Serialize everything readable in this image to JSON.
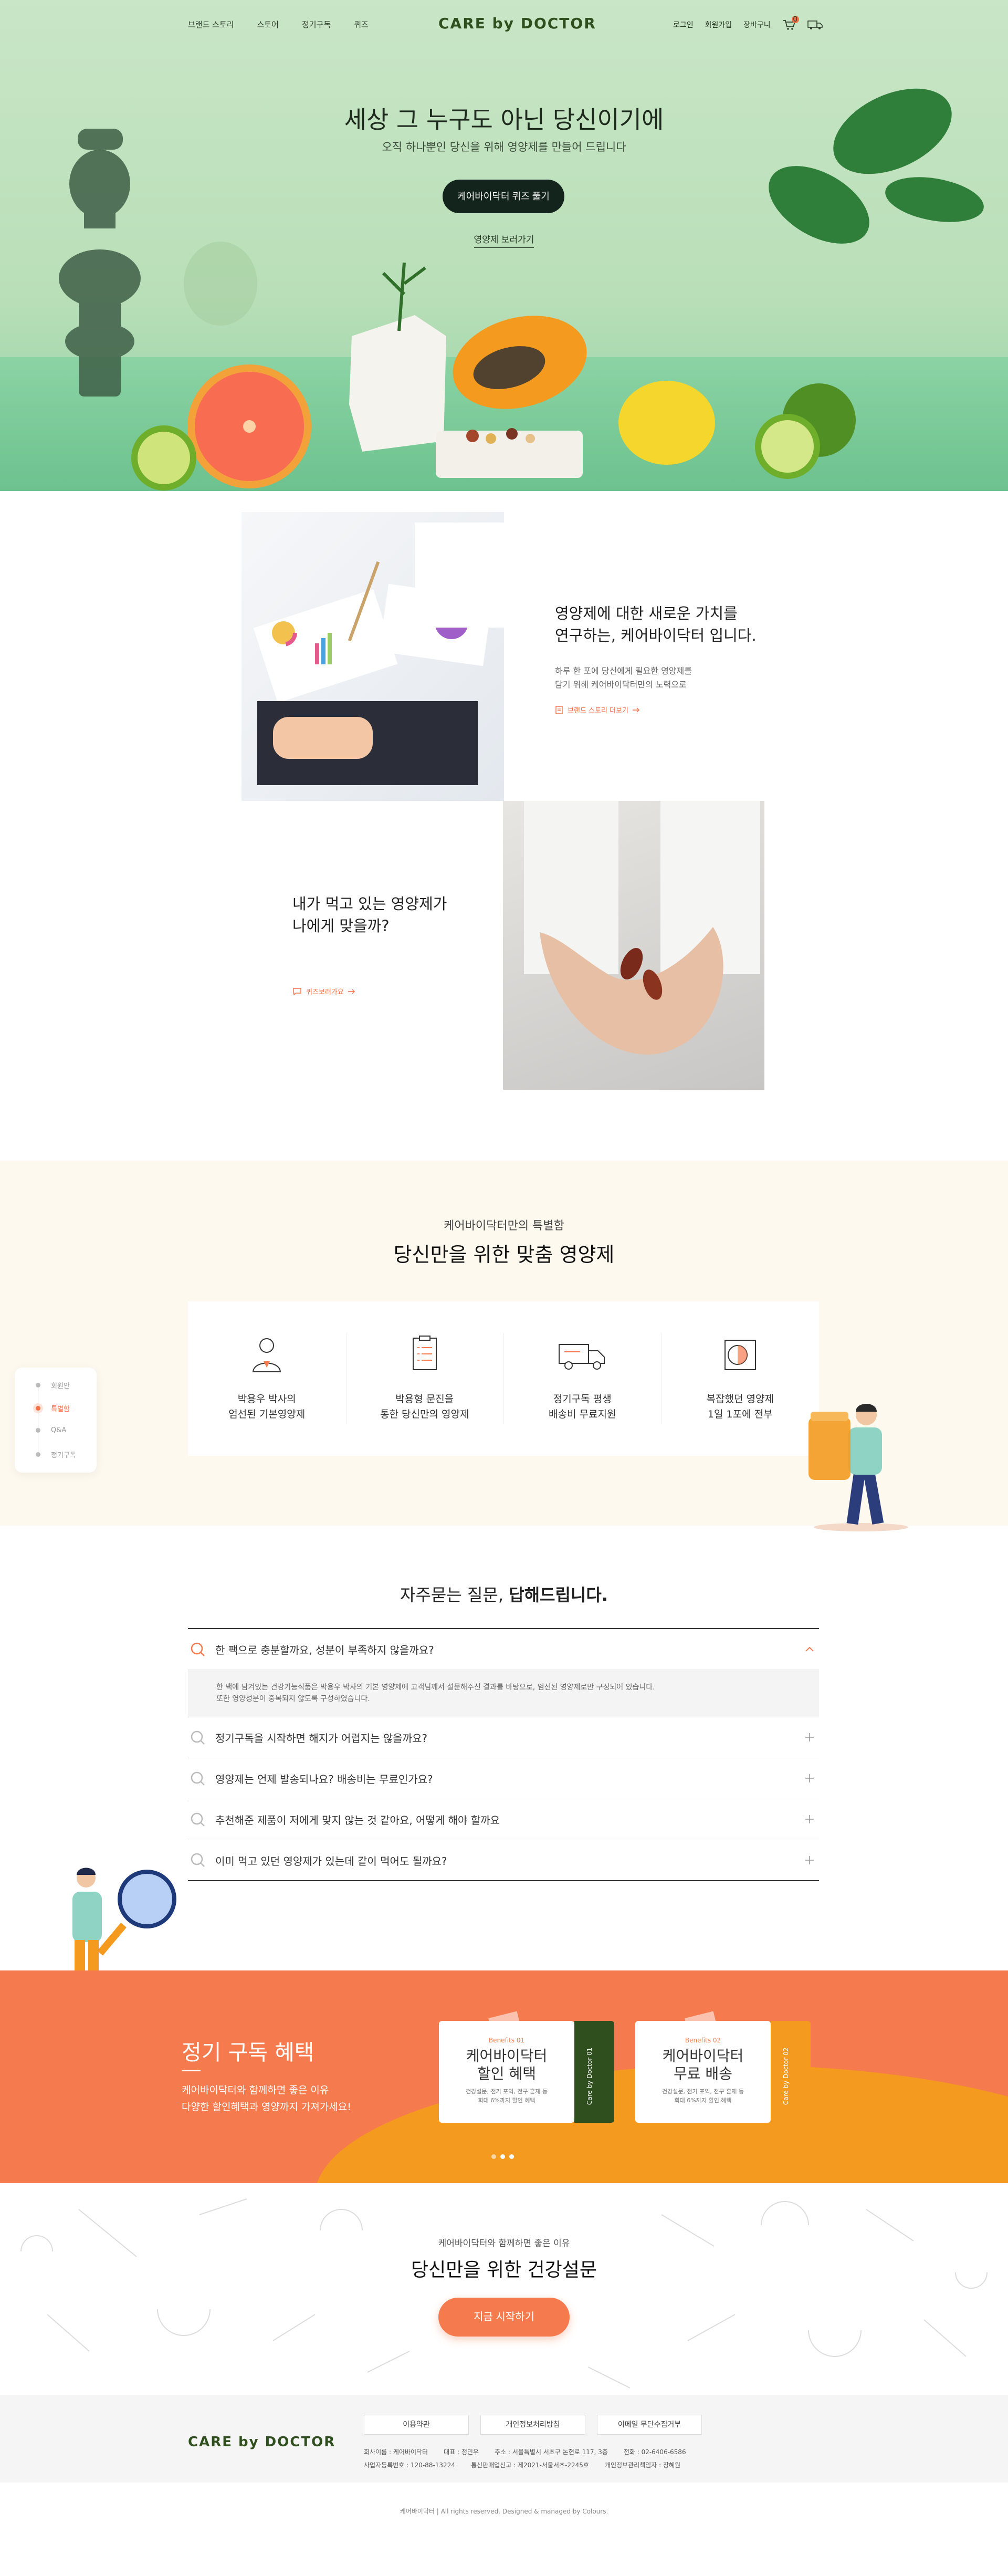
{
  "nav": {
    "left": [
      "브랜드 스토리",
      "스토어",
      "정기구독",
      "퀴즈"
    ],
    "logo": "CARE by DOCTOR",
    "right": [
      "로그인",
      "회원가입",
      "장바구니"
    ],
    "cart_count": "0"
  },
  "hero": {
    "title": "세상 그 누구도 아닌 당신이기에",
    "subtitle": "오직 하나뿐인 당신을 위해 영양제를 만들어 드립니다",
    "quiz_button": "케어바이닥터 퀴즈 풀기",
    "link": "영양제 보러가기"
  },
  "intro": {
    "block1": {
      "title_line1": "영양제에 대한 새로운 가치를",
      "title_line2": "연구하는, 케어바이닥터 입니다.",
      "desc_line1": "하루 한 포에 당신에게 필요한 영양제를",
      "desc_line2": "담기 위해 케어바이닥터만의 노력으로",
      "more": "브랜드 스토리 더보기"
    },
    "block2": {
      "title_line1": "내가 먹고 있는 영양제가",
      "title_line2": "나에게 맞을까?",
      "more": "퀴즈보러가요"
    }
  },
  "personal": {
    "small": "케어바이닥터만의 특별함",
    "title": "당신만을 위한 맞춤 영양제",
    "cards": [
      {
        "line1": "박용우 박사의",
        "line2": "엄선된 기본영양제",
        "icon": "doctor-icon"
      },
      {
        "line1": "박용형 문진을",
        "line2": "통한 당신만의 영양제",
        "icon": "clipboard-icon"
      },
      {
        "line1": "정기구독 평생",
        "line2": "배송비 무료지원",
        "icon": "truck-icon"
      },
      {
        "line1": "복잡했던 영양제",
        "line2": "1일 1포에 전부",
        "icon": "pill-pack-icon"
      }
    ]
  },
  "sidenav": {
    "items": [
      "회원안",
      "특별함",
      "Q&A",
      "정기구독"
    ]
  },
  "faq": {
    "title_normal": "자주묻는 질문, ",
    "title_bold": "답해드립니다.",
    "items": [
      {
        "q": "한 팩으로 충분할까요, 성분이 부족하지 않을까요?",
        "open": true
      },
      {
        "q": "정기구독을 시작하면 해지가 어렵지는 않을까요?",
        "open": false
      },
      {
        "q": "영양제는 언제 발송되나요? 배송비는 무료인가요?",
        "open": false
      },
      {
        "q": "추천해준 제품이 저에게 맞지 않는 것 같아요, 어떻게 해야 할까요",
        "open": false
      },
      {
        "q": "이미 먹고 있던 영양제가 있는데 같이 먹어도 될까요?",
        "open": false
      }
    ],
    "answer_line1": "한 팩에 담겨있는 건강기능식품은 박용우 박사의 기본 영양제에 고객님께서 설문해주신 결과를 바탕으로, 엄선된 영양제로만 구성되어 있습니다.",
    "answer_line2": "또한 영양성분이 중복되지 않도록 구성하였습니다."
  },
  "subscription": {
    "title": "정기 구독 혜택",
    "desc_line1": "케어바이닥터와 함께하면 좋은 이유",
    "desc_line2": "다양한 할인혜택과 영양까지 가져가세요!",
    "coupons": [
      {
        "benefit": "Benefits 01",
        "title_line1": "케어바이닥터",
        "title_line2": "할인 혜택",
        "desc_line1": "건강설문, 전기 포익, 전구 흔재 등",
        "desc_line2": "회대 6%까지 할인 혜택",
        "tab": "Care by Doctor 01",
        "tab_color": "#2f4f1e"
      },
      {
        "benefit": "Benefits 02",
        "title_line1": "케어바이닥터",
        "title_line2": "무료 배송",
        "desc_line1": "건강설문, 전기 포익, 전구 흔재 등",
        "desc_line2": "회대 6%까지 할인 혜택",
        "tab": "Care by Doctor 02",
        "tab_color": "#f39a1f"
      }
    ]
  },
  "survey": {
    "small": "케어바이닥터와 함께하면 좋은 이유",
    "title": "당신만을 위한 건강설문",
    "button": "지금 시작하기"
  },
  "footer": {
    "logo": "CARE by DOCTOR",
    "links": [
      "이용약관",
      "개인정보처리방침",
      "이메일 무단수집거부"
    ],
    "info_row1": [
      "회사이름 : 케어바이닥터",
      "대표 : 정민우",
      "주소 : 서울특별시 서초구 논현로 117, 3층",
      "전화 : 02-6406-6586"
    ],
    "info_row2": [
      "사업자등록번호 : 120-88-13224",
      "통신판매업신고 : 제2021-서울서초-2245호",
      "개인정보관리책임자 : 장혜원"
    ],
    "copyright": "케어바이닥터 | All rights reserved. Designed & managed by Colours."
  },
  "colors": {
    "accent": "#f57b4e",
    "brand_green": "#2f4f1e",
    "hero_bg": "#c9e6c6",
    "personal_bg": "#fdf9ee",
    "orange": "#f39a1f"
  }
}
